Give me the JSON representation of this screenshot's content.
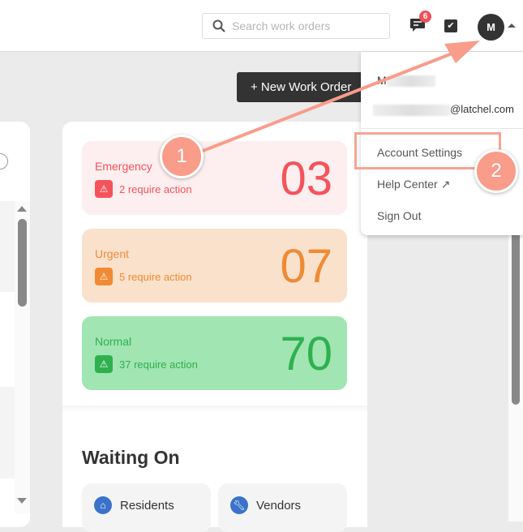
{
  "header": {
    "search_placeholder": "Search work orders",
    "chat_badge": "6",
    "avatar_initial": "M"
  },
  "toolbar": {
    "new_work_order": "+ New Work Order"
  },
  "priorities": [
    {
      "label": "Emergency",
      "action": "2 require action",
      "count": "03",
      "color": "#f5535c",
      "bg": "#fdeeef"
    },
    {
      "label": "Urgent",
      "action": "5 require action",
      "count": "07",
      "color": "#f08a35",
      "bg": "#fae1cb"
    },
    {
      "label": "Normal",
      "action": "37 require action",
      "count": "70",
      "color": "#2fb04f",
      "bg": "#a0e5b2"
    }
  ],
  "waiting": {
    "title": "Waiting On",
    "items": [
      {
        "label": "Residents",
        "icon": "home-icon"
      },
      {
        "label": "Vendors",
        "icon": "wrench-icon"
      }
    ]
  },
  "menu": {
    "name": "M",
    "email_suffix": "@latchel.com",
    "items": [
      "Account Settings",
      "Help Center",
      "Sign Out"
    ]
  },
  "annotations": {
    "step1": "1",
    "step2": "2",
    "color": "#f99c8a"
  }
}
